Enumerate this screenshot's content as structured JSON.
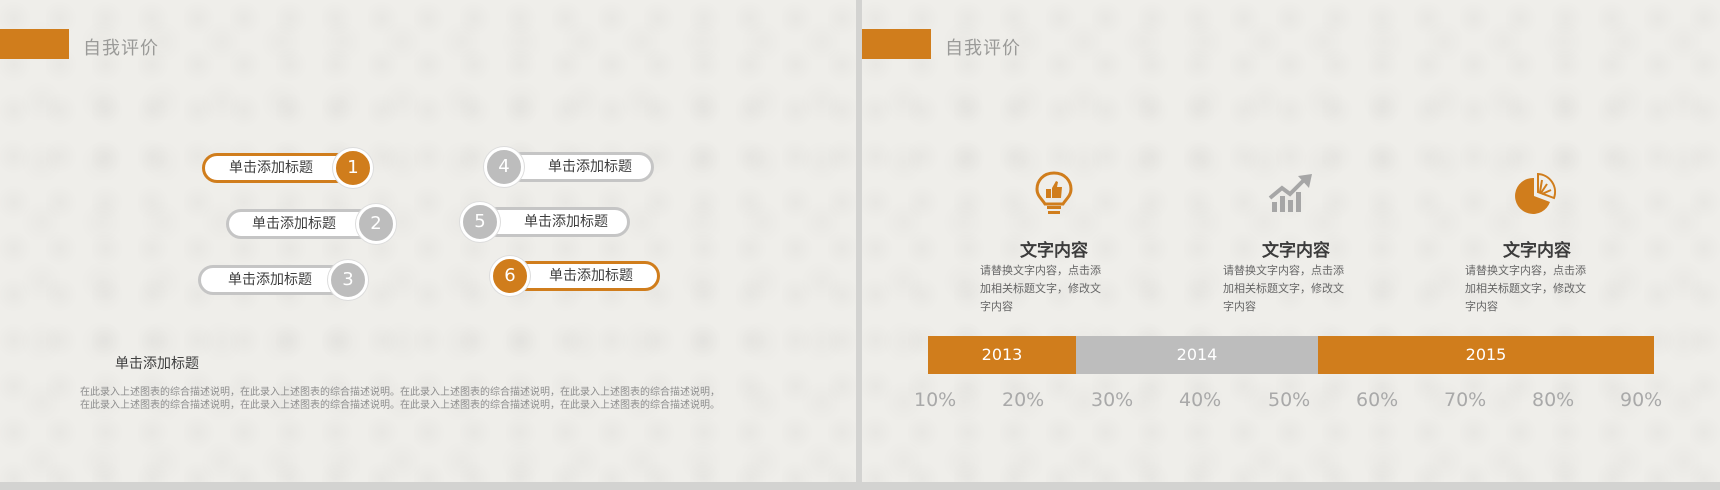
{
  "colors": {
    "accent": "#d07d1c",
    "gray": "#bdbdbd"
  },
  "left": {
    "header_title": "自我评价",
    "buttons": [
      {
        "num": "1",
        "label": "单击添加标题"
      },
      {
        "num": "2",
        "label": "单击添加标题"
      },
      {
        "num": "3",
        "label": "单击添加标题"
      },
      {
        "num": "4",
        "label": "单击添加标题"
      },
      {
        "num": "5",
        "label": "单击添加标题"
      },
      {
        "num": "6",
        "label": "单击添加标题"
      }
    ],
    "desc_title": "单击添加标题",
    "desc_lines": [
      "在此录入上述图表的综合描述说明，在此录入上述图表的综合描述说明。在此录入上述图表的综合描述说明，在此录入上述图表的综合描述说明，",
      "在此录入上述图表的综合描述说明，在此录入上述图表的综合描述说明。在此录入上述图表的综合描述说明，在此录入上述图表的综合描述说明。"
    ]
  },
  "right": {
    "header_title": "自我评价",
    "features": [
      {
        "icon": "lightbulb-icon",
        "title": "文字内容",
        "lines": [
          "请替换文字内容，点击添",
          "加相关标题文字，修改文",
          "字内容"
        ]
      },
      {
        "icon": "growth-chart-icon",
        "title": "文字内容",
        "lines": [
          "请替换文字内容，点击添",
          "加相关标题文字，修改文",
          "字内容"
        ]
      },
      {
        "icon": "pie-chart-icon",
        "title": "文字内容",
        "lines": [
          "请替换文字内容，点击添",
          "加相关标题文字，修改文",
          "字内容"
        ]
      }
    ],
    "timeline": [
      "2013",
      "2014",
      "2015"
    ],
    "percent_labels": [
      "10%",
      "20%",
      "30%",
      "40%",
      "50%",
      "60%",
      "70%",
      "80%",
      "90%"
    ]
  }
}
